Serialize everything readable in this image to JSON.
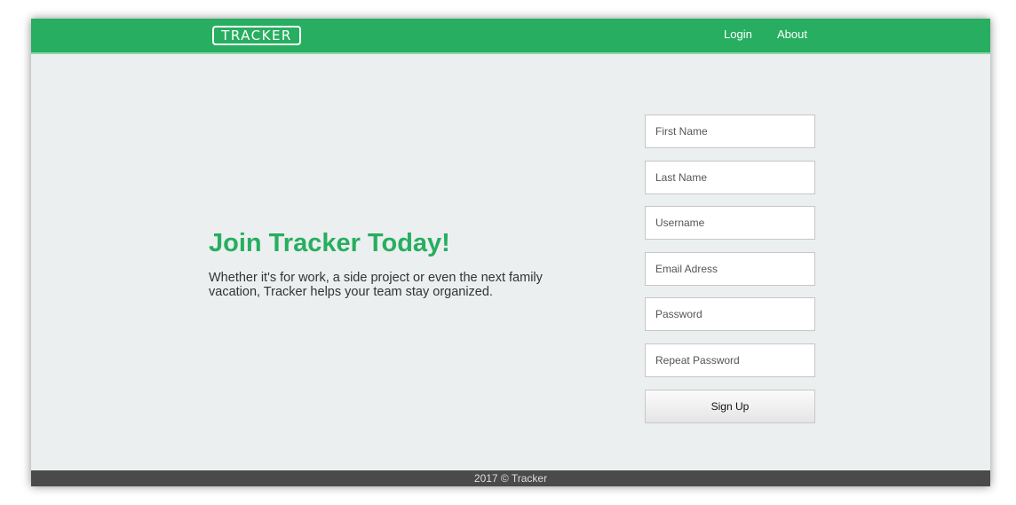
{
  "colors": {
    "accent": "#27ae60",
    "background": "#ecefef",
    "footer_bg": "#4a4a4a"
  },
  "navbar": {
    "logo_text": "TRACKER",
    "links": [
      {
        "label": "Login"
      },
      {
        "label": "About"
      }
    ]
  },
  "hero": {
    "title": "Join Tracker Today!",
    "text": "Whether it's for work, a side project or even the next family vacation, Tracker helps your team stay organized."
  },
  "signup_form": {
    "fields": [
      {
        "placeholder": "First Name",
        "value": ""
      },
      {
        "placeholder": "Last Name",
        "value": ""
      },
      {
        "placeholder": "Username",
        "value": ""
      },
      {
        "placeholder": "Email Adress",
        "value": ""
      },
      {
        "placeholder": "Password",
        "value": ""
      },
      {
        "placeholder": "Repeat Password",
        "value": ""
      }
    ],
    "submit_label": "Sign Up"
  },
  "footer": {
    "text": "2017 © Tracker"
  }
}
